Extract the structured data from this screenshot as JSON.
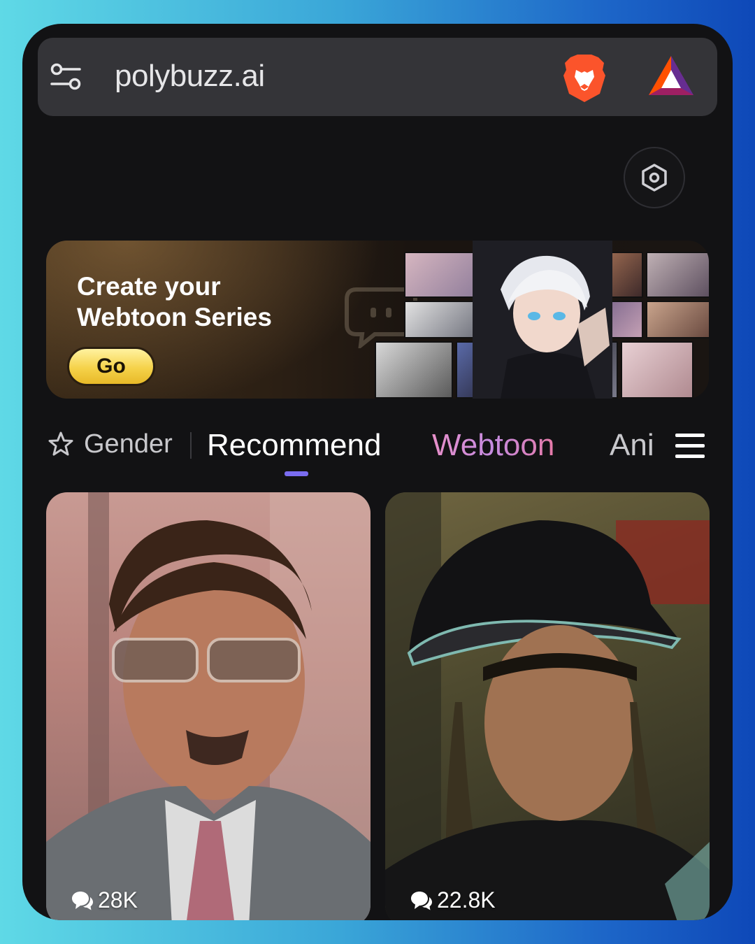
{
  "browser": {
    "url": "polybuzz.ai",
    "icons": [
      "tune-icon",
      "brave-lion-icon",
      "bat-rewards-icon"
    ]
  },
  "header": {
    "settings_icon": "hexagon-settings-icon"
  },
  "banner": {
    "title_line1": "Create your",
    "title_line2": "Webtoon Series",
    "go_label": "Go"
  },
  "tabs": {
    "gender_label": "Gender",
    "items": [
      {
        "label": "Recommend",
        "active": true
      },
      {
        "label": "Webtoon",
        "active": false
      },
      {
        "label": "Ani",
        "active": false
      }
    ],
    "menu_icon": "hamburger-menu-icon",
    "accent_color": "#7a6cf0"
  },
  "cards": [
    {
      "chat_count": "28K"
    },
    {
      "chat_count": "22.8K"
    }
  ]
}
